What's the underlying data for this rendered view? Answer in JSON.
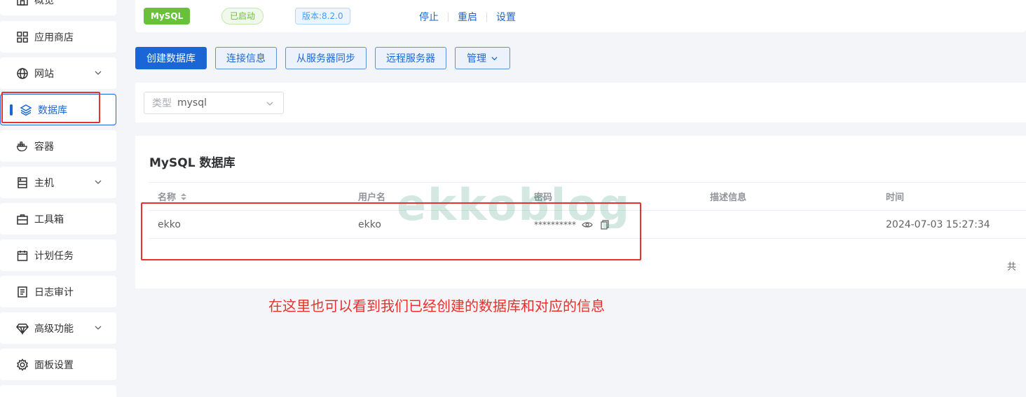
{
  "sidebar": {
    "items": [
      {
        "label": "概览",
        "icon": "home-icon"
      },
      {
        "label": "应用商店",
        "icon": "apps-grid-icon"
      },
      {
        "label": "网站",
        "icon": "globe-icon",
        "expandable": true
      },
      {
        "label": "数据库",
        "icon": "layers-icon",
        "active": true
      },
      {
        "label": "容器",
        "icon": "docker-icon"
      },
      {
        "label": "主机",
        "icon": "server-icon",
        "expandable": true
      },
      {
        "label": "工具箱",
        "icon": "toolbox-icon"
      },
      {
        "label": "计划任务",
        "icon": "calendar-icon"
      },
      {
        "label": "日志审计",
        "icon": "log-icon"
      },
      {
        "label": "高级功能",
        "icon": "diamond-icon",
        "expandable": true
      },
      {
        "label": "面板设置",
        "icon": "gear-icon"
      }
    ]
  },
  "status": {
    "app_tag": "MySQL",
    "state": "已启动",
    "version": "版本:8.2.0",
    "actions": [
      "停止",
      "重启",
      "设置"
    ]
  },
  "toolbar": {
    "create": "创建数据库",
    "connect": "连接信息",
    "sync": "从服务器同步",
    "remote": "远程服务器",
    "manage": "管理"
  },
  "filter": {
    "prefix": "类型",
    "value": "mysql"
  },
  "db_table": {
    "title": "MySQL 数据库",
    "columns": [
      "名称",
      "用户名",
      "密码",
      "描述信息",
      "时间"
    ],
    "rows": [
      {
        "name": "ekko",
        "username": "ekko",
        "password": "**********",
        "description": "",
        "time": "2024-07-03 15:27:34"
      }
    ],
    "total_prefix": "共"
  },
  "annotation": {
    "text": "在这里也可以看到我们已经创建的数据库和对应的信息",
    "color": "#e5322d"
  },
  "watermark": {
    "text": "ekkoblog"
  },
  "colors": {
    "accent": "#1a66d6",
    "success": "#67c23a",
    "annotation": "#e5322d"
  }
}
